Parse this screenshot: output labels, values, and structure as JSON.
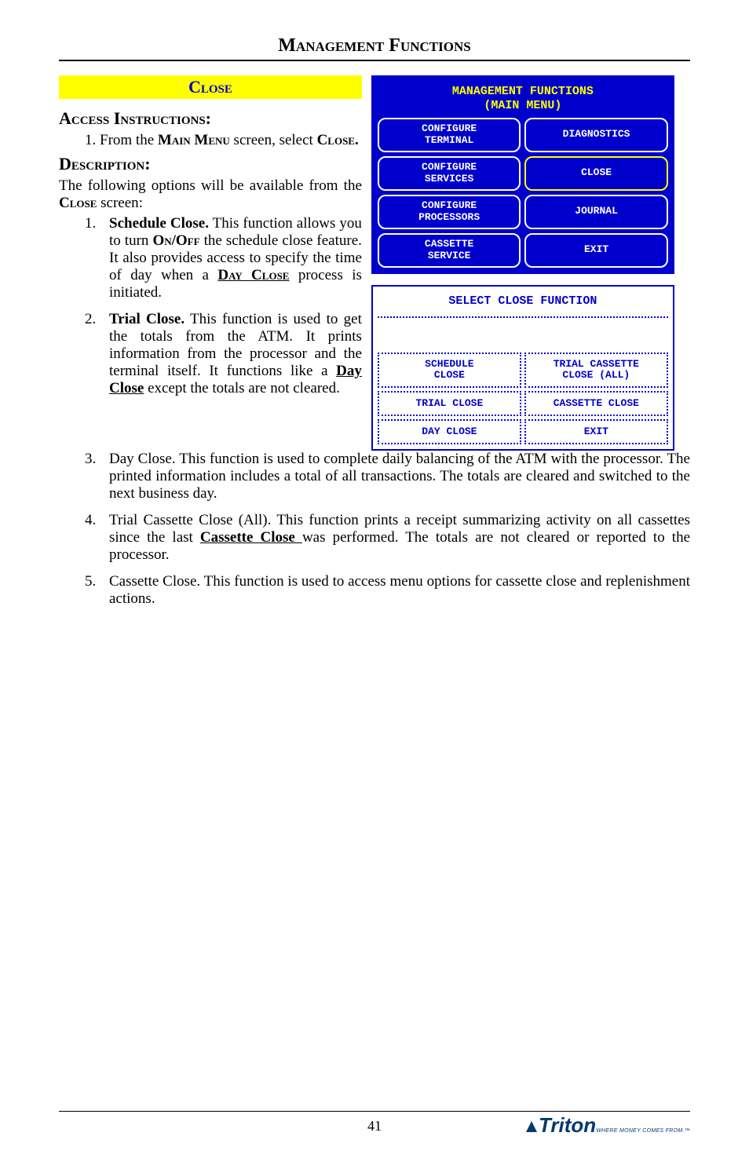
{
  "header": "Management Functions",
  "title_box": "Close",
  "access_heading": "Access Instructions:",
  "access_step_prefix": "From the ",
  "access_step_menu": "Main Menu",
  "access_step_mid": " screen, select ",
  "access_step_target": "Close.",
  "desc_heading": "Description:",
  "desc_intro_1": "The following options will be available from the ",
  "desc_intro_close": "Close",
  "desc_intro_2": " screen:",
  "opts": [
    {
      "title": "Schedule Close.",
      "p1": "  This function allows you to turn ",
      "onoff": "On/Off",
      "p2": " the schedule close feature. It also provides access to specify the time of day when a ",
      "dayclose": "Day Close",
      "p3": " process is initiated."
    },
    {
      "title": "Trial Close.",
      "p1": " This function is used to get the totals from the ATM.  It prints information from the processor and the terminal itself.   It functions like a ",
      "dayclose": "Day Close",
      "p2": " except the totals are not cleared."
    }
  ],
  "full_opts": [
    {
      "title": "Day Close.",
      "text": "  This function is used to complete daily balancing of the ATM with the processor. The printed information includes a total of all transactions. The totals are cleared and switched to the next business day."
    },
    {
      "title": "Trial Cassette Close (All).",
      "p1": " This function prints a receipt summarizing activity on all cassettes since the last ",
      "cc": "Cassette Close ",
      "p2": "was performed. The totals are not cleared or reported to the processor."
    },
    {
      "title": "Cassette Close.",
      "text": "  This function is used to access menu options for cassette close and replenishment actions."
    }
  ],
  "main_menu": {
    "title": "MANAGEMENT FUNCTIONS\n(MAIN MENU)",
    "buttons": [
      "CONFIGURE\nTERMINAL",
      "DIAGNOSTICS",
      "CONFIGURE\nSERVICES",
      "CLOSE",
      "CONFIGURE\nPROCESSORS",
      "JOURNAL",
      "CASSETTE\nSERVICE",
      "EXIT"
    ]
  },
  "close_menu": {
    "title": "SELECT CLOSE FUNCTION",
    "buttons": [
      "",
      "",
      "SCHEDULE\nCLOSE",
      "TRIAL CASSETTE\nCLOSE (ALL)",
      "TRIAL CLOSE",
      "CASSETTE CLOSE",
      "DAY CLOSE",
      "EXIT"
    ]
  },
  "page_num": "41",
  "logo": "Triton",
  "logo_tag": "WHERE MONEY COMES FROM.™"
}
